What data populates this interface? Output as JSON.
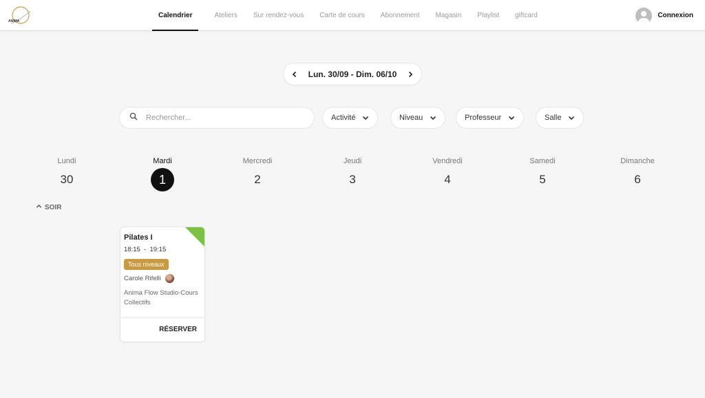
{
  "header": {
    "logo_text": "ANIMA",
    "nav": [
      {
        "label": "Calendrier",
        "active": true
      },
      {
        "label": "Ateliers"
      },
      {
        "label": "Sur rendez-vous"
      },
      {
        "label": "Carte de cours"
      },
      {
        "label": "Abonnement"
      },
      {
        "label": "Magasin"
      },
      {
        "label": "Playlist"
      },
      {
        "label": "giftcard"
      }
    ],
    "login_label": "Connexion",
    "icons": {
      "login": "user-avatar-icon"
    }
  },
  "week": {
    "label": "Lun. 30/09 - Dim. 06/10",
    "icons": {
      "prev": "chevron-left-icon",
      "next": "chevron-right-icon"
    }
  },
  "filters": {
    "search_placeholder": "Rechercher...",
    "search_value": "",
    "dropdowns": [
      "Activité",
      "Niveau",
      "Professeur",
      "Salle"
    ]
  },
  "days": [
    {
      "name": "Lundi",
      "number": "30"
    },
    {
      "name": "Mardi",
      "number": "1",
      "selected": true
    },
    {
      "name": "Mercredi",
      "number": "2"
    },
    {
      "name": "Jeudi",
      "number": "3"
    },
    {
      "name": "Vendredi",
      "number": "4"
    },
    {
      "name": "Samedi",
      "number": "5"
    },
    {
      "name": "Dimanche",
      "number": "6"
    }
  ],
  "section": {
    "label": "SOIR"
  },
  "class_card": {
    "title": "Pilates I",
    "time": "18:15  -  19:15",
    "level": "Tous niveaux",
    "teacher": "Carole Rifelli",
    "location": "Anima Flow Studio-Cours Collectifs",
    "book_label": "RÉSERVER",
    "corner_color": "#7cc242",
    "badge_color": "#c99a40"
  },
  "colors": {
    "background": "#f6f6f6",
    "accent": "#111111"
  }
}
